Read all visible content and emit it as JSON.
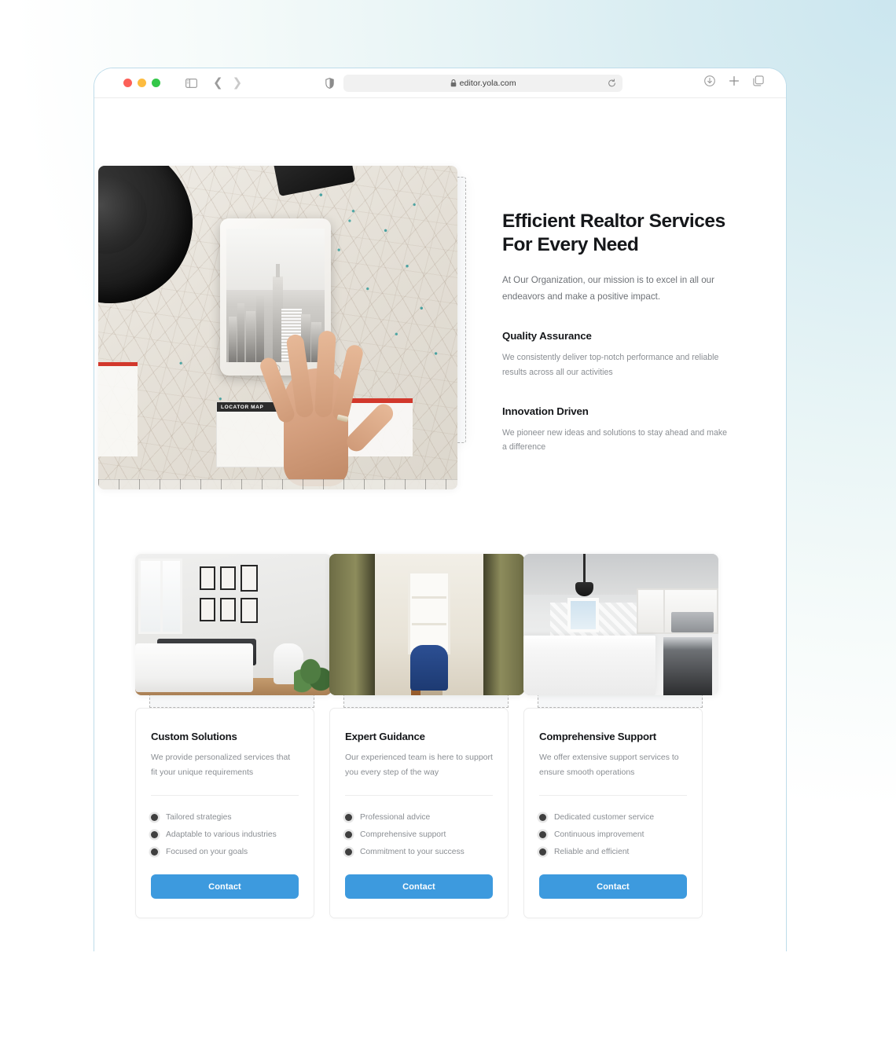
{
  "browser": {
    "url": "editor.yola.com",
    "icons": {
      "sidebar": "sidebar-toggle-icon",
      "back": "chevron-left-icon",
      "forward": "chevron-right-icon",
      "shield": "shield-icon",
      "lock": "lock-icon",
      "reload": "reload-icon",
      "download": "download-icon",
      "new_tab": "plus-icon",
      "tabs": "tabs-icon"
    },
    "traffic_lights": [
      "close-red",
      "minimize-yellow",
      "maximize-green"
    ]
  },
  "hero": {
    "heading": "Efficient Realtor Services For Every Need",
    "subtitle": "At Our Organization, our mission is to excel in all our endeavors and make a positive impact.",
    "image_alt": "hand-on-road-map-with-tablet",
    "features": [
      {
        "title": "Quality Assurance",
        "desc": "We consistently deliver top-notch performance and reliable results across all our activities"
      },
      {
        "title": "Innovation Driven",
        "desc": "We pioneer new ideas and solutions to stay ahead and make a difference"
      }
    ]
  },
  "cards": [
    {
      "image_alt": "bedroom-interior",
      "title": "Custom Solutions",
      "desc": "We provide personalized services that fit your unique requirements",
      "items": [
        "Tailored strategies",
        "Adaptable to various industries",
        "Focused on your goals"
      ],
      "button": "Contact"
    },
    {
      "image_alt": "study-room-interior",
      "title": "Expert Guidance",
      "desc": "Our experienced team is here to support you every step of the way",
      "items": [
        "Professional advice",
        "Comprehensive support",
        "Commitment to your success"
      ],
      "button": "Contact"
    },
    {
      "image_alt": "kitchen-interior",
      "title": "Comprehensive Support",
      "desc": "We offer extensive support services to ensure smooth operations",
      "items": [
        "Dedicated customer service",
        "Continuous improvement",
        "Reliable and efficient"
      ],
      "button": "Contact"
    }
  ],
  "colors": {
    "accent_button": "#3d9ade",
    "heading": "#15171a",
    "body_text": "#8a8e93",
    "backdrop_blue": "#cbe6ef",
    "backdrop_mint": "#e7f5f0",
    "window_border": "#bedcea",
    "dashed_outline": "#b6b6b6"
  }
}
